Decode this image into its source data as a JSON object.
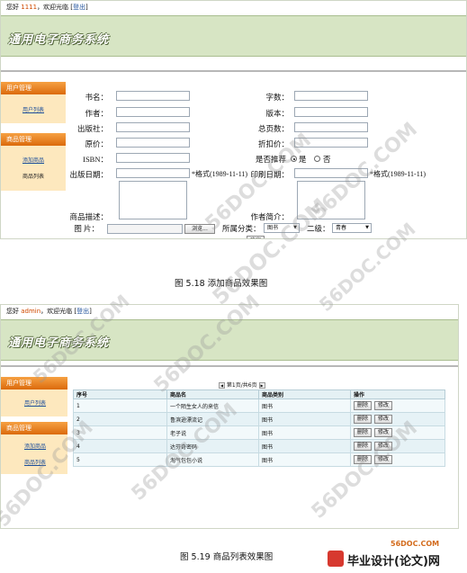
{
  "screen1": {
    "topbar": {
      "greeting": "您好",
      "user": "1111",
      "welcome": "，欢迎光临",
      "bracket_open": "[",
      "logout": "登出",
      "bracket_close": "]"
    },
    "banner_title": "通用电子商务系统",
    "sidebar": {
      "section1": {
        "title": "用户管理",
        "items": [
          "用户列表"
        ]
      },
      "section2": {
        "title": "商品管理",
        "items": [
          "添加商品",
          "商品列表"
        ]
      }
    },
    "form": {
      "book_name": "书名：",
      "author": "作者：",
      "publisher": "出版社：",
      "price": "原价：",
      "isbn": "ISBN：",
      "pub_date": "出版日期：",
      "pub_date_note": "*格式(1989-11-11)",
      "word_count": "字数：",
      "edition": "版本：",
      "total_pages": "总页数：",
      "discount_price": "折扣价：",
      "recommend": "是否推荐",
      "yes": "是",
      "no": "否",
      "print_date": "印刷日期：",
      "print_date_note": "*格式(1989-11-11)",
      "description": "商品描述：",
      "author_intro": "作者简介：",
      "image": "图  片：",
      "browse": "浏览...",
      "category": "所属分类：",
      "category_value": "图书",
      "subcategory": "二级：",
      "subcategory_value": "青春",
      "confirm": "确定"
    },
    "caption": "图  5.18 添加商品效果图"
  },
  "screen2": {
    "topbar": {
      "greeting": "您好",
      "user": "admin",
      "welcome": "，欢迎光临",
      "bracket_open": "[",
      "logout": "登出",
      "bracket_close": "]"
    },
    "banner_title": "通用电子商务系统",
    "sidebar": {
      "section1": {
        "title": "用户管理",
        "items": [
          "用户列表"
        ]
      },
      "section2": {
        "title": "商品管理",
        "items": [
          "添加商品",
          "商品列表"
        ]
      }
    },
    "pager": "第1页/共6页",
    "table": {
      "headers": [
        "序号",
        "商品名",
        "商品类别",
        "操作"
      ],
      "rows": [
        {
          "no": "1",
          "name": "一个陌生女人的来信",
          "category": "图书"
        },
        {
          "no": "2",
          "name": "鲁滨逊漂流记",
          "category": "图书"
        },
        {
          "no": "3",
          "name": "老子说",
          "category": "图书"
        },
        {
          "no": "4",
          "name": "达芬奇密码",
          "category": "图书"
        },
        {
          "no": "5",
          "name": "淘气包包小说",
          "category": "图书"
        }
      ],
      "delete": "删除",
      "edit": "修改"
    },
    "caption": "图  5.19 商品列表效果图"
  },
  "watermarks": [
    "56DOC.COM",
    "56DOC.COM",
    "56DOC.COM",
    "56DOC.COM",
    "56DOC.COM",
    "56DOC.COM",
    "56DOC.COM",
    "56DOC.COM",
    "56DOC.COM"
  ],
  "logo": {
    "small": "56DOC.COM",
    "big": "毕业设计(论文)网"
  },
  "colors": {
    "banner": "#d7e5c4",
    "sidebar_header": "#e8811e",
    "sidebar_body": "#fde8be",
    "link": "#1d4f9a",
    "table_header": "#e5f1f4"
  }
}
